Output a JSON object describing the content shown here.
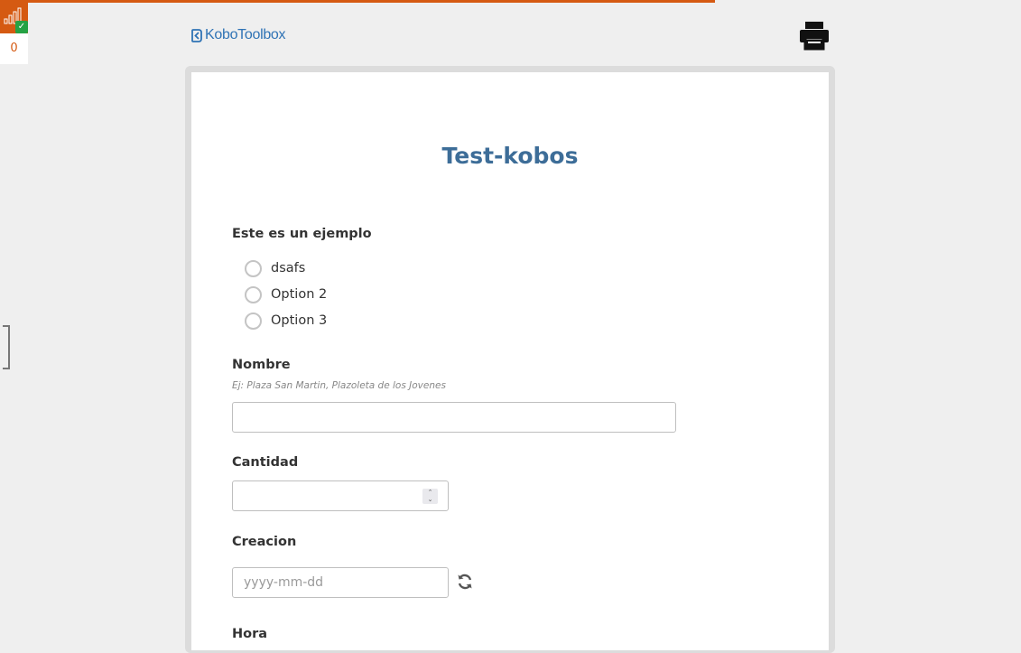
{
  "progress": {
    "fraction": 0.7,
    "color": "#d55a12"
  },
  "queue_widget": {
    "count": "0",
    "icons": [
      "signal-bars-icon",
      "check-icon"
    ]
  },
  "header": {
    "logo_text": "KoboToolbox",
    "print_icon": "printer-icon"
  },
  "form": {
    "title": "Test-kobos",
    "questions": {
      "ejemplo": {
        "label": "Este es un ejemplo",
        "options": [
          "dsafs",
          "Option 2",
          "Option 3"
        ]
      },
      "nombre": {
        "label": "Nombre",
        "hint": "Ej: Plaza San Martin, Plazoleta de los Jovenes",
        "value": ""
      },
      "cantidad": {
        "label": "Cantidad",
        "value": ""
      },
      "creacion": {
        "label": "Creacion",
        "placeholder": "yyyy-mm-dd",
        "refresh_icon": "refresh-icon"
      },
      "hora": {
        "label": "Hora"
      }
    }
  },
  "colors": {
    "accent": "#d55a12",
    "title": "#3d6d98",
    "logo": "#2f73b5",
    "success": "#25a244"
  }
}
